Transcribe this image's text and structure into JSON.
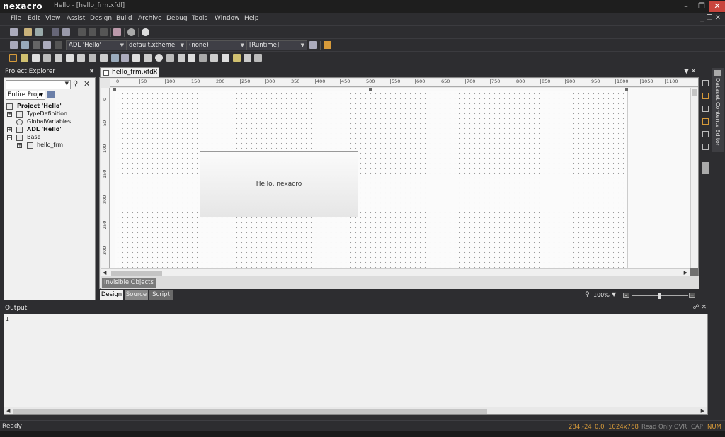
{
  "window": {
    "app_logo": "nexacro",
    "title": "Hello - [hello_frm.xfdl]"
  },
  "menu": [
    "File",
    "Edit",
    "View",
    "Assist",
    "Design",
    "Build",
    "Archive",
    "Debug",
    "Tools",
    "Window",
    "Help"
  ],
  "toolbar": {
    "adl_combo": "ADL 'Hello'",
    "theme_combo": "default.xtheme",
    "screen_combo": "(none)",
    "runtime_combo": "[Runtime]"
  },
  "project_explorer": {
    "title": "Project Explorer",
    "scope": "Entire Proje",
    "tree": [
      {
        "label": "Project 'Hello'",
        "bold": true
      },
      {
        "label": "TypeDefinition",
        "bold": false
      },
      {
        "label": "GlobalVariables",
        "bold": false
      },
      {
        "label": "ADL 'Hello'",
        "bold": true
      },
      {
        "label": "Base",
        "bold": false
      },
      {
        "label": "hello_frm",
        "bold": false
      }
    ]
  },
  "document": {
    "tab_label": "hello_frm.xfdl",
    "button_text": "Hello, nexacro",
    "invisible_objects_tab": "Invisible Objects",
    "ruler_h": [
      "0",
      "50",
      "100",
      "150",
      "200",
      "250",
      "300",
      "350",
      "400",
      "450",
      "500",
      "550",
      "600",
      "650",
      "700",
      "750",
      "800",
      "850",
      "900",
      "950",
      "1000",
      "1050",
      "1100"
    ],
    "ruler_v": [
      "0",
      "50",
      "100",
      "150",
      "200",
      "250",
      "300"
    ],
    "view_tabs": [
      "Design",
      "Source",
      "Script"
    ],
    "zoom": "100%"
  },
  "side_panel": {
    "dataset_editor": "Dataset Contents Editor"
  },
  "output": {
    "title": "Output",
    "line1": "1"
  },
  "status": {
    "ready": "Ready",
    "coords": "284,-24",
    "value": "0.0",
    "resolution": "1024x768",
    "readonly": "Read Only",
    "ovr": "OVR",
    "cap": "CAP",
    "num": "NUM"
  },
  "colors": {
    "chrome_bg": "#2d2d30",
    "status_accent": "#d69a3a",
    "close_red": "#c9453d"
  }
}
